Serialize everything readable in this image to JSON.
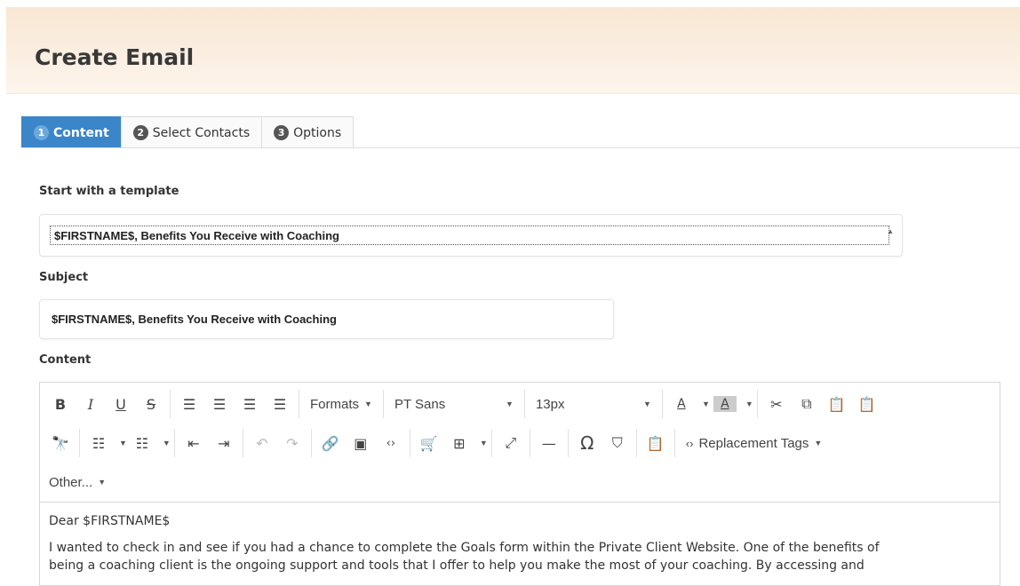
{
  "header": {
    "title": "Create Email"
  },
  "tabs": [
    {
      "num": "1",
      "label": "Content"
    },
    {
      "num": "2",
      "label": "Select Contacts"
    },
    {
      "num": "3",
      "label": "Options"
    }
  ],
  "template": {
    "label": "Start with a template",
    "selected": "$FIRSTNAME$, Benefits You Receive with Coaching"
  },
  "subject": {
    "label": "Subject",
    "value": "$FIRSTNAME$, Benefits You Receive with Coaching"
  },
  "content": {
    "label": "Content"
  },
  "toolbar": {
    "formats": "Formats",
    "font": "PT Sans",
    "size": "13px",
    "text_color_glyph": "A",
    "bg_color_glyph": "A",
    "replacement_tags": "Replacement Tags",
    "other": "Other...",
    "bold": "B",
    "italic": "I",
    "underline": "U",
    "strike": "S",
    "omega": "Ω"
  },
  "body": {
    "greeting": "Dear $FIRSTNAME$",
    "para1": "I wanted to check in and see if you had a chance to complete the Goals form within the Private Client Website. One of the benefits of",
    "para2": "being a coaching client is the ongoing support and tools that I offer to help you make the most of your coaching. By accessing and"
  },
  "colors": {
    "accent": "#3a86c8",
    "header_bg": "#f8e7d3"
  }
}
